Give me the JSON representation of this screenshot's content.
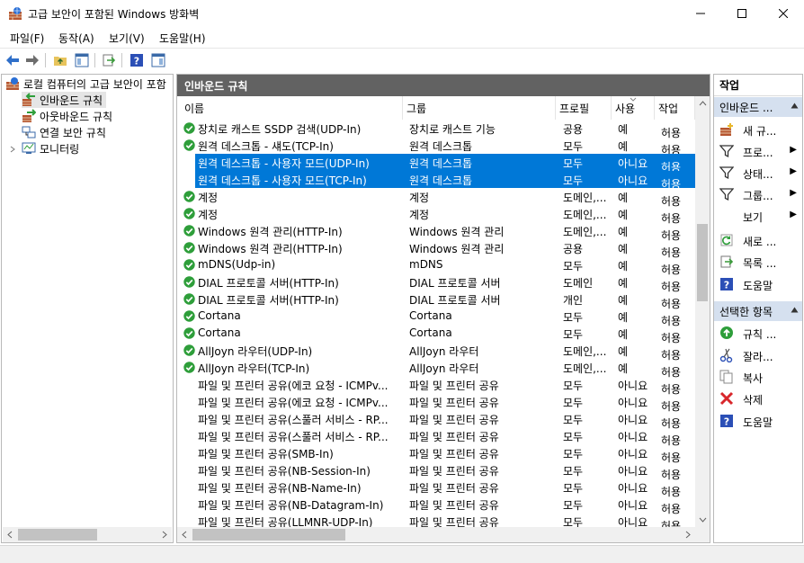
{
  "window": {
    "title": "고급 보안이 포함된 Windows 방화벽"
  },
  "menu": {
    "file": "파일(F)",
    "action": "동작(A)",
    "view": "보기(V)",
    "help": "도움말(H)"
  },
  "tree": {
    "root": "로컬 컴퓨터의 고급 보안이 포함",
    "inbound": "인바운드 규칙",
    "outbound": "아웃바운드 규칙",
    "connsec": "연결 보안 규칙",
    "monitoring": "모니터링"
  },
  "center": {
    "header": "인바운드 규칙",
    "columns": {
      "name": "이름",
      "group": "그룹",
      "profile": "프로필",
      "enabled": "사용",
      "action": "작업"
    }
  },
  "rules": [
    {
      "name": "장치로 캐스트 SSDP 검색(UDP-In)",
      "group": "장치로 캐스트 기능",
      "profile": "공용",
      "enabled": "예",
      "action": "허용",
      "active": true,
      "selected": false
    },
    {
      "name": "원격 데스크톱 - 섀도(TCP-In)",
      "group": "원격 데스크톱",
      "profile": "모두",
      "enabled": "예",
      "action": "허용",
      "active": true,
      "selected": false
    },
    {
      "name": "원격 데스크톱 - 사용자 모드(UDP-In)",
      "group": "원격 데스크톱",
      "profile": "모두",
      "enabled": "아니요",
      "action": "허용",
      "active": false,
      "selected": true
    },
    {
      "name": "원격 데스크톱 - 사용자 모드(TCP-In)",
      "group": "원격 데스크톱",
      "profile": "모두",
      "enabled": "아니요",
      "action": "허용",
      "active": false,
      "selected": true
    },
    {
      "name": "계정",
      "group": "계정",
      "profile": "도메인,...",
      "enabled": "예",
      "action": "허용",
      "active": true,
      "selected": false
    },
    {
      "name": "계정",
      "group": "계정",
      "profile": "도메인,...",
      "enabled": "예",
      "action": "허용",
      "active": true,
      "selected": false
    },
    {
      "name": "Windows 원격 관리(HTTP-In)",
      "group": "Windows 원격 관리",
      "profile": "도메인,...",
      "enabled": "예",
      "action": "허용",
      "active": true,
      "selected": false
    },
    {
      "name": "Windows 원격 관리(HTTP-In)",
      "group": "Windows 원격 관리",
      "profile": "공용",
      "enabled": "예",
      "action": "허용",
      "active": true,
      "selected": false
    },
    {
      "name": "mDNS(Udp-in)",
      "group": "mDNS",
      "profile": "모두",
      "enabled": "예",
      "action": "허용",
      "active": true,
      "selected": false
    },
    {
      "name": "DIAL 프로토콜 서버(HTTP-In)",
      "group": "DIAL 프로토콜 서버",
      "profile": "도메인",
      "enabled": "예",
      "action": "허용",
      "active": true,
      "selected": false
    },
    {
      "name": "DIAL 프로토콜 서버(HTTP-In)",
      "group": "DIAL 프로토콜 서버",
      "profile": "개인",
      "enabled": "예",
      "action": "허용",
      "active": true,
      "selected": false
    },
    {
      "name": "Cortana",
      "group": "Cortana",
      "profile": "모두",
      "enabled": "예",
      "action": "허용",
      "active": true,
      "selected": false
    },
    {
      "name": "Cortana",
      "group": "Cortana",
      "profile": "모두",
      "enabled": "예",
      "action": "허용",
      "active": true,
      "selected": false
    },
    {
      "name": "AllJoyn 라우터(UDP-In)",
      "group": "AllJoyn 라우터",
      "profile": "도메인,...",
      "enabled": "예",
      "action": "허용",
      "active": true,
      "selected": false
    },
    {
      "name": "AllJoyn 라우터(TCP-In)",
      "group": "AllJoyn 라우터",
      "profile": "도메인,...",
      "enabled": "예",
      "action": "허용",
      "active": true,
      "selected": false
    },
    {
      "name": "파일 및 프린터 공유(에코 요청 - ICMPv...",
      "group": "파일 및 프린터 공유",
      "profile": "모두",
      "enabled": "아니요",
      "action": "허용",
      "active": false,
      "selected": false
    },
    {
      "name": "파일 및 프린터 공유(에코 요청 - ICMPv...",
      "group": "파일 및 프린터 공유",
      "profile": "모두",
      "enabled": "아니요",
      "action": "허용",
      "active": false,
      "selected": false
    },
    {
      "name": "파일 및 프린터 공유(스풀러 서비스 - RP...",
      "group": "파일 및 프린터 공유",
      "profile": "모두",
      "enabled": "아니요",
      "action": "허용",
      "active": false,
      "selected": false
    },
    {
      "name": "파일 및 프린터 공유(스풀러 서비스 - RP...",
      "group": "파일 및 프린터 공유",
      "profile": "모두",
      "enabled": "아니요",
      "action": "허용",
      "active": false,
      "selected": false
    },
    {
      "name": "파일 및 프린터 공유(SMB-In)",
      "group": "파일 및 프린터 공유",
      "profile": "모두",
      "enabled": "아니요",
      "action": "허용",
      "active": false,
      "selected": false
    },
    {
      "name": "파일 및 프린터 공유(NB-Session-In)",
      "group": "파일 및 프린터 공유",
      "profile": "모두",
      "enabled": "아니요",
      "action": "허용",
      "active": false,
      "selected": false
    },
    {
      "name": "파일 및 프린터 공유(NB-Name-In)",
      "group": "파일 및 프린터 공유",
      "profile": "모두",
      "enabled": "아니요",
      "action": "허용",
      "active": false,
      "selected": false
    },
    {
      "name": "파일 및 프린터 공유(NB-Datagram-In)",
      "group": "파일 및 프린터 공유",
      "profile": "모두",
      "enabled": "아니요",
      "action": "허용",
      "active": false,
      "selected": false
    },
    {
      "name": "파일 및 프린터 공유(LLMNR-UDP-In)",
      "group": "파일 및 프린터 공유",
      "profile": "모두",
      "enabled": "아니요",
      "action": "허용",
      "active": false,
      "selected": false
    }
  ],
  "actions": {
    "header": "작업",
    "section1": "인바운드 ...",
    "new_rule": "새 규...",
    "filter_profile": "프로...",
    "filter_state": "상태...",
    "filter_group": "그룹...",
    "view": "보기",
    "refresh": "새로 ...",
    "export": "목록 ...",
    "help1": "도움말",
    "section2": "선택한 항목",
    "enable_rule": "규칙 ...",
    "cut": "잘라...",
    "copy": "복사",
    "delete": "삭제",
    "help2": "도움말"
  },
  "colors": {
    "selection": "#0078d7",
    "pane_header": "#626262",
    "section_header": "#d5e0ef",
    "check_green": "#2e9e3a"
  }
}
